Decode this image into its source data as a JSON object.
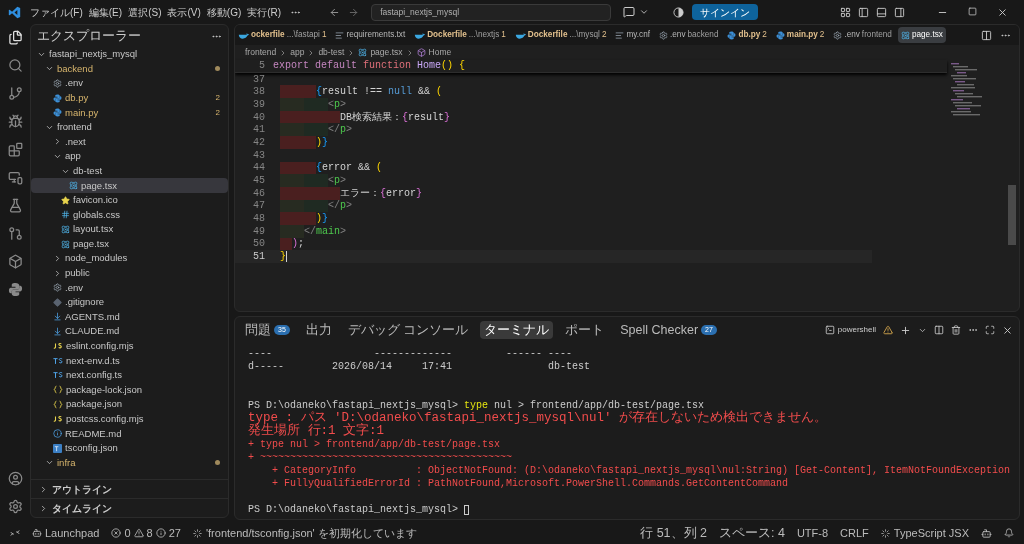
{
  "title_bar": {
    "menu": [
      "ファイル(F)",
      "編集(E)",
      "選択(S)",
      "表示(V)",
      "移動(G)",
      "実行(R)"
    ],
    "search": "fastapi_nextjs_mysql",
    "sign_in": "サインイン"
  },
  "sidebar": {
    "title": "エクスプローラー",
    "tree": {
      "name": "fastapi_nextjs_mysql",
      "kind": "folder",
      "expanded": true,
      "selected": false,
      "modified": false,
      "children": [
        {
          "name": "backend",
          "kind": "folder",
          "expanded": true,
          "selected": false,
          "modified": true,
          "children": [
            {
              "name": ".env",
              "kind": "gear",
              "selected": false,
              "modified": false
            },
            {
              "name": "db.py",
              "kind": "python",
              "selected": false,
              "modified": true,
              "badge": "2"
            },
            {
              "name": "main.py",
              "kind": "python",
              "selected": false,
              "modified": true,
              "badge": "2"
            }
          ]
        },
        {
          "name": "frontend",
          "kind": "folder",
          "expanded": true,
          "selected": false,
          "modified": false,
          "children": [
            {
              "name": ".next",
              "kind": "folder",
              "expanded": false,
              "selected": false,
              "modified": false
            },
            {
              "name": "app",
              "kind": "folder",
              "expanded": true,
              "selected": false,
              "modified": false,
              "children": [
                {
                  "name": "db-test",
                  "kind": "folder",
                  "expanded": true,
                  "selected": false,
                  "modified": false,
                  "children": [
                    {
                      "name": "page.tsx",
                      "kind": "react",
                      "selected": true,
                      "modified": false
                    }
                  ]
                },
                {
                  "name": "favicon.ico",
                  "kind": "star",
                  "selected": false,
                  "modified": false
                },
                {
                  "name": "globals.css",
                  "kind": "hash",
                  "selected": false,
                  "modified": false
                },
                {
                  "name": "layout.tsx",
                  "kind": "react",
                  "selected": false,
                  "modified": false
                },
                {
                  "name": "page.tsx",
                  "kind": "react",
                  "selected": false,
                  "modified": false
                }
              ]
            },
            {
              "name": "node_modules",
              "kind": "folder",
              "expanded": false,
              "selected": false,
              "modified": false
            },
            {
              "name": "public",
              "kind": "folder",
              "expanded": false,
              "selected": false,
              "modified": false
            },
            {
              "name": ".env",
              "kind": "gear",
              "selected": false,
              "modified": false
            },
            {
              "name": ".gitignore",
              "kind": "diamond",
              "selected": false,
              "modified": false
            },
            {
              "name": "AGENTS.md",
              "kind": "markdown",
              "selected": false,
              "modified": false
            },
            {
              "name": "CLAUDE.md",
              "kind": "markdown",
              "selected": false,
              "modified": false
            },
            {
              "name": "eslint.config.mjs",
              "kind": "js",
              "selected": false,
              "modified": false
            },
            {
              "name": "next-env.d.ts",
              "kind": "ts",
              "selected": false,
              "modified": false
            },
            {
              "name": "next.config.ts",
              "kind": "ts",
              "selected": false,
              "modified": false
            },
            {
              "name": "package-lock.json",
              "kind": "json",
              "selected": false,
              "modified": false
            },
            {
              "name": "package.json",
              "kind": "json",
              "selected": false,
              "modified": false
            },
            {
              "name": "postcss.config.mjs",
              "kind": "js",
              "selected": false,
              "modified": false
            },
            {
              "name": "README.md",
              "kind": "info",
              "selected": false,
              "modified": false
            },
            {
              "name": "tsconfig.json",
              "kind": "tsconfig",
              "selected": false,
              "modified": false
            }
          ]
        },
        {
          "name": "infra",
          "kind": "folder",
          "expanded": true,
          "selected": false,
          "modified": true
        }
      ]
    },
    "sections": [
      {
        "label": "アウトライン",
        "expanded": false
      },
      {
        "label": "タイムライン",
        "expanded": false
      }
    ]
  },
  "editor": {
    "tabs": [
      {
        "label": "ockerfile",
        "description": "...\\fastapi",
        "badge": "1",
        "kind": "docker",
        "warning": true,
        "selected": false
      },
      {
        "label": "requirements.txt",
        "kind": "lines",
        "warning": false,
        "selected": false
      },
      {
        "label": "Dockerfile",
        "description": "...\\nextjs",
        "badge": "1",
        "kind": "docker",
        "warning": true,
        "selected": false
      },
      {
        "label": "Dockerfile",
        "description": "...\\mysql",
        "badge": "2",
        "kind": "docker",
        "warning": true,
        "selected": false
      },
      {
        "label": "my.cnf",
        "kind": "lines",
        "warning": false,
        "selected": false
      },
      {
        "label": ".env",
        "description": "backend",
        "kind": "gear",
        "warning": false,
        "selected": false
      },
      {
        "label": "db.py",
        "badge": "2",
        "kind": "python",
        "warning": true,
        "selected": false
      },
      {
        "label": "main.py",
        "badge": "2",
        "kind": "python",
        "warning": true,
        "selected": false
      },
      {
        "label": ".env",
        "description": "frontend",
        "kind": "gear",
        "warning": false,
        "selected": false
      },
      {
        "label": "page.tsx",
        "kind": "react",
        "warning": false,
        "selected": true
      }
    ],
    "breadcrumbs": [
      {
        "label": "frontend",
        "kind": "folder"
      },
      {
        "label": "app",
        "kind": "folder"
      },
      {
        "label": "db-test",
        "kind": "folder"
      },
      {
        "label": "page.tsx",
        "kind": "react"
      },
      {
        "label": "Home",
        "kind": "symbol"
      }
    ],
    "sticky_line": {
      "number": "5",
      "tokens": [
        {
          "text": "export default ",
          "kind": "keyword"
        },
        {
          "text": "function ",
          "kind": "storage"
        },
        {
          "text": "Home",
          "kind": "function"
        },
        {
          "text": "() {",
          "kind": "bracket1"
        }
      ]
    },
    "lines": [
      {
        "number": "37",
        "current": false
      },
      {
        "number": "38",
        "current": false,
        "indent_error": true,
        "tokens": [
          {
            "text": "      {",
            "kind": "bracket3"
          },
          {
            "text": "result !== ",
            "kind": "plain"
          },
          {
            "text": "null",
            "kind": "constant"
          },
          {
            "text": " && ",
            "kind": "plain"
          },
          {
            "text": "(",
            "kind": "bracket1"
          }
        ]
      },
      {
        "number": "39",
        "current": false,
        "indent_error": false,
        "tokens": [
          {
            "text": "        <",
            "kind": "tagpunct"
          },
          {
            "text": "p",
            "kind": "tag"
          },
          {
            "text": ">",
            "kind": "tagpunct"
          }
        ]
      },
      {
        "number": "40",
        "current": false,
        "indent_error": true,
        "tokens": [
          {
            "text": "          DB検索結果：",
            "kind": "plain"
          },
          {
            "text": "{",
            "kind": "bracket2"
          },
          {
            "text": "result",
            "kind": "plain"
          },
          {
            "text": "}",
            "kind": "bracket2"
          }
        ]
      },
      {
        "number": "41",
        "current": false,
        "indent_error": false,
        "tokens": [
          {
            "text": "        </",
            "kind": "tagpunct"
          },
          {
            "text": "p",
            "kind": "tag"
          },
          {
            "text": ">",
            "kind": "tagpunct"
          }
        ]
      },
      {
        "number": "42",
        "current": false,
        "indent_error": true,
        "tokens": [
          {
            "text": "      )",
            "kind": "bracket1"
          },
          {
            "text": "}",
            "kind": "bracket3"
          }
        ]
      },
      {
        "number": "43",
        "current": false
      },
      {
        "number": "44",
        "current": false,
        "indent_error": true,
        "tokens": [
          {
            "text": "      {",
            "kind": "bracket3"
          },
          {
            "text": "error && ",
            "kind": "plain"
          },
          {
            "text": "(",
            "kind": "bracket1"
          }
        ]
      },
      {
        "number": "45",
        "current": false,
        "indent_error": false,
        "tokens": [
          {
            "text": "        <",
            "kind": "tagpunct"
          },
          {
            "text": "p",
            "kind": "tag"
          },
          {
            "text": ">",
            "kind": "tagpunct"
          }
        ]
      },
      {
        "number": "46",
        "current": false,
        "indent_error": true,
        "tokens": [
          {
            "text": "          エラー：",
            "kind": "plain"
          },
          {
            "text": "{",
            "kind": "bracket2"
          },
          {
            "text": "error",
            "kind": "plain"
          },
          {
            "text": "}",
            "kind": "bracket2"
          }
        ]
      },
      {
        "number": "47",
        "current": false,
        "indent_error": false,
        "tokens": [
          {
            "text": "        </",
            "kind": "tagpunct"
          },
          {
            "text": "p",
            "kind": "tag"
          },
          {
            "text": ">",
            "kind": "tagpunct"
          }
        ]
      },
      {
        "number": "48",
        "current": false,
        "indent_error": true,
        "tokens": [
          {
            "text": "      )",
            "kind": "bracket1"
          },
          {
            "text": "}",
            "kind": "bracket3"
          }
        ]
      },
      {
        "number": "49",
        "current": false,
        "indent_error": false,
        "tokens": [
          {
            "text": "    </",
            "kind": "tagpunct"
          },
          {
            "text": "main",
            "kind": "tag"
          },
          {
            "text": ">",
            "kind": "tagpunct"
          }
        ]
      },
      {
        "number": "50",
        "current": false,
        "indent_error": true,
        "tokens": [
          {
            "text": "  )",
            "kind": "bracket2"
          },
          {
            "text": ";",
            "kind": "plain"
          }
        ]
      },
      {
        "number": "51",
        "current": true,
        "tokens": [
          {
            "text": "}",
            "kind": "bracket1"
          }
        ]
      }
    ]
  },
  "panel": {
    "tabs": [
      {
        "label": "問題",
        "badge": "35",
        "selected": false
      },
      {
        "label": "出力",
        "selected": false
      },
      {
        "label": "デバッグ コンソール",
        "selected": false
      },
      {
        "label": "ターミナル",
        "selected": true
      },
      {
        "label": "ポート",
        "selected": false
      },
      {
        "label": "Spell Checker",
        "badge": "27",
        "selected": false
      }
    ],
    "shell": "powershell",
    "lines": [
      {
        "kind": "text",
        "segments": [
          {
            "text": "----                 -------------         ------ ----",
            "kind": "plain"
          }
        ]
      },
      {
        "kind": "text",
        "segments": [
          {
            "text": "d-----        2026/08/14     17:41                db-test",
            "kind": "plain"
          }
        ]
      },
      {
        "kind": "blank"
      },
      {
        "kind": "blank"
      },
      {
        "kind": "text",
        "segments": [
          {
            "text": "PS D:\\odaneko\\fastapi_nextjs_mysql> ",
            "kind": "plain"
          },
          {
            "text": "type",
            "kind": "command"
          },
          {
            "text": " nul > frontend/app/db-test/page.tsx",
            "kind": "plain"
          }
        ]
      },
      {
        "kind": "text",
        "segments": [
          {
            "text": "type : パス 'D:\\odaneko\\fastapi_nextjs_mysql\\nul' が存在しないため検出できません。",
            "kind": "error"
          }
        ]
      },
      {
        "kind": "text",
        "segments": [
          {
            "text": "発生場所 行:1 文字:1",
            "kind": "error"
          }
        ]
      },
      {
        "kind": "text",
        "segments": [
          {
            "text": "+ type nul > frontend/app/db-test/page.tsx",
            "kind": "error"
          }
        ]
      },
      {
        "kind": "text",
        "segments": [
          {
            "text": "+ ~~~~~~~~~~~~~~~~~~~~~~~~~~~~~~~~~~~~~~~~~~",
            "kind": "error"
          }
        ]
      },
      {
        "kind": "text",
        "segments": [
          {
            "text": "    + CategoryInfo          : ObjectNotFound: (D:\\odaneko\\fastapi_nextjs_mysql\\nul:String) [Get-Content], ItemNotFoundException",
            "kind": "error"
          }
        ]
      },
      {
        "kind": "text",
        "segments": [
          {
            "text": "    + FullyQualifiedErrorId : PathNotFound,Microsoft.PowerShell.Commands.GetContentCommand",
            "kind": "error"
          }
        ]
      },
      {
        "kind": "blank"
      },
      {
        "kind": "prompt",
        "segments": [
          {
            "text": "PS D:\\odaneko\\fastapi_nextjs_mysql> ",
            "kind": "plain"
          }
        ]
      }
    ]
  },
  "status_bar": {
    "launchpad": "Launchpad",
    "errors": "0",
    "warnings": "8",
    "infos": "27",
    "progress": "'frontend/tsconfig.json' を初期化しています",
    "right": [
      {
        "text": "行 51、列 2",
        "kind": "plain"
      },
      {
        "text": "スペース: 4",
        "kind": "plain"
      },
      {
        "text": "UTF-8",
        "kind": "plain"
      },
      {
        "text": "CRLF",
        "kind": "plain"
      },
      {
        "text": "TypeScript JSX",
        "kind": "loading"
      }
    ]
  }
}
